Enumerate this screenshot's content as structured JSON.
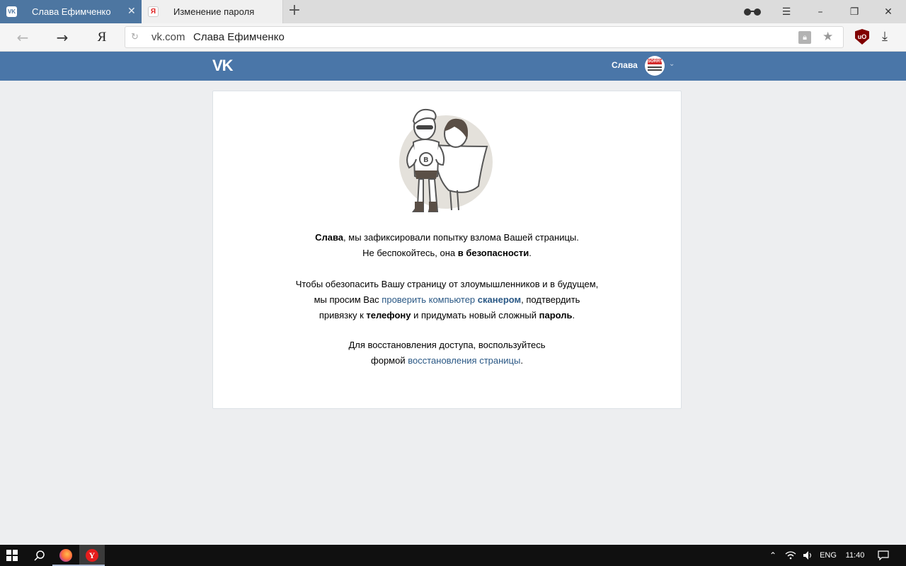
{
  "browser": {
    "tabs": [
      {
        "label": "Слава Ефимченко",
        "favicon": "VK",
        "active": true
      },
      {
        "label": "Изменение пароля",
        "favicon": "Я",
        "active": false
      }
    ],
    "address": {
      "domain": "vk.com",
      "title": "Слава Ефимченко"
    },
    "yandex_button": "Я",
    "ublock_label": "uO"
  },
  "vk": {
    "logo": "VK",
    "user_name": "Слава",
    "avatar_badge": "SORRY"
  },
  "message": {
    "p1_name": "Слава",
    "p1_rest": ", мы зафиксировали попытку взлома Вашей страницы.",
    "p2_start": "Не беспокойтесь, она ",
    "p2_bold": "в безопасности",
    "p2_end": ".",
    "p3_line1": "Чтобы обезопасить Вашу страницу от злоумышленников и в будущем,",
    "p3_before_link": "мы просим Вас ",
    "p3_link_text": "проверить компьютер ",
    "p3_link_bold": "сканером",
    "p3_after_link": ", подтвердить",
    "p4_start": "привязку к ",
    "p4_bold1": "телефону",
    "p4_mid": " и придумать новый сложный ",
    "p4_bold2": "пароль",
    "p4_end": ".",
    "p5_line1": "Для восстановления доступа, воспользуйтесь",
    "p5_before_link": "формой ",
    "p5_link": "восстановления страницы",
    "p5_end": "."
  },
  "taskbar": {
    "language": "ENG",
    "time": "11:40"
  }
}
